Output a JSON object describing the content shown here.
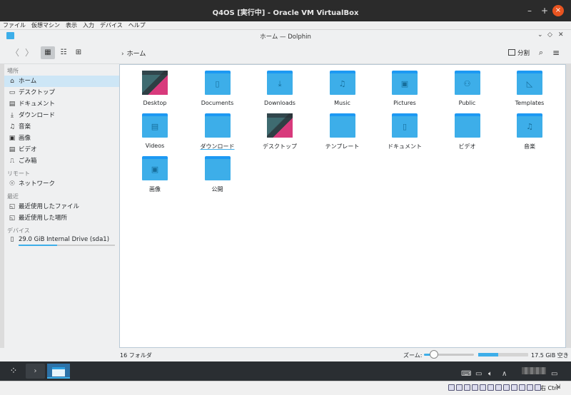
{
  "vm_window": {
    "title": "Q4OS [実行中] - Oracle VM VirtualBox",
    "minimize": "–",
    "maximize": "+",
    "close": "×"
  },
  "vbox_menu": [
    "ファイル",
    "仮想マシン",
    "表示",
    "入力",
    "デバイス",
    "ヘルプ"
  ],
  "dolphin_title": "ホーム — Dolphin",
  "dolphin_title_controls": [
    "⌄",
    "◇",
    "✕"
  ],
  "toolbar": {
    "back": "〈",
    "forward": "〉",
    "breadcrumb_sep": "›",
    "breadcrumb": "ホーム",
    "split_label": "分割",
    "search_icon": "search-icon",
    "menu_icon": "hamburger-icon"
  },
  "sidebar": {
    "places_header": "場所",
    "places": [
      {
        "label": "ホーム",
        "icon": "home-icon",
        "selected": true
      },
      {
        "label": "デスクトップ",
        "icon": "desktop-icon"
      },
      {
        "label": "ドキュメント",
        "icon": "documents-icon"
      },
      {
        "label": "ダウンロード",
        "icon": "download-icon"
      },
      {
        "label": "音楽",
        "icon": "music-icon"
      },
      {
        "label": "画像",
        "icon": "pictures-icon"
      },
      {
        "label": "ビデオ",
        "icon": "video-icon"
      },
      {
        "label": "ごみ箱",
        "icon": "trash-icon"
      }
    ],
    "remote_header": "リモート",
    "remote": [
      {
        "label": "ネットワーク",
        "icon": "network-icon"
      }
    ],
    "recent_header": "最近",
    "recent": [
      {
        "label": "最近使用したファイル",
        "icon": "recent-files-icon"
      },
      {
        "label": "最近使用した場所",
        "icon": "recent-locations-icon"
      }
    ],
    "devices_header": "デバイス",
    "devices": [
      {
        "label": "29.0 GiB Internal Drive (sda1)",
        "icon": "drive-icon",
        "usage_fraction": 0.4
      }
    ]
  },
  "folders": [
    {
      "name": "Desktop",
      "kind": "desktop"
    },
    {
      "name": "Documents",
      "kind": "folder",
      "emblem": "▯"
    },
    {
      "name": "Downloads",
      "kind": "folder",
      "emblem": "⤓"
    },
    {
      "name": "Music",
      "kind": "folder",
      "emblem": "♫"
    },
    {
      "name": "Pictures",
      "kind": "folder",
      "emblem": "▣"
    },
    {
      "name": "Public",
      "kind": "folder",
      "emblem": "⚇"
    },
    {
      "name": "Templates",
      "kind": "folder",
      "emblem": "◺"
    },
    {
      "name": "Videos",
      "kind": "folder",
      "emblem": "▤"
    },
    {
      "name": "ダウンロード",
      "kind": "folder",
      "emblem": "",
      "underlined": true
    },
    {
      "name": "デスクトップ",
      "kind": "desktop"
    },
    {
      "name": "テンプレート",
      "kind": "folder",
      "emblem": ""
    },
    {
      "name": "ドキュメント",
      "kind": "folder",
      "emblem": "▯"
    },
    {
      "name": "ビデオ",
      "kind": "folder",
      "emblem": ""
    },
    {
      "name": "音楽",
      "kind": "folder",
      "emblem": "♫"
    },
    {
      "name": "画像",
      "kind": "folder",
      "emblem": "▣"
    },
    {
      "name": "公開",
      "kind": "folder",
      "emblem": ""
    }
  ],
  "statusbar": {
    "count": "16 フォルダ",
    "zoom_label": "ズーム:",
    "zoom_fraction": 0.2,
    "disk_used_fraction": 0.4,
    "free_space": "17.5 GiB 空き"
  },
  "vbox_status": {
    "host_key": "右 Ctrl",
    "arrow": "⇲"
  },
  "colors": {
    "accent": "#3daee9",
    "folder": "#3daee9",
    "folder_tab": "#1d99f3",
    "taskbar": "#2a2e32",
    "close_button": "#e95420"
  }
}
